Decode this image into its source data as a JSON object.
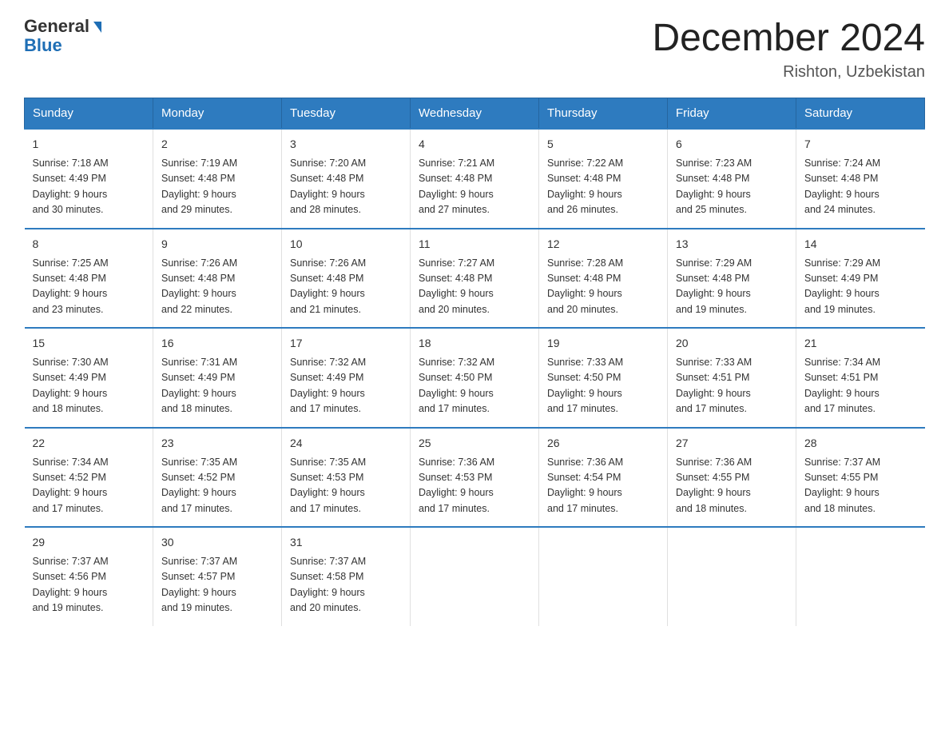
{
  "logo": {
    "general": "General",
    "blue": "Blue"
  },
  "title": "December 2024",
  "location": "Rishton, Uzbekistan",
  "headers": [
    "Sunday",
    "Monday",
    "Tuesday",
    "Wednesday",
    "Thursday",
    "Friday",
    "Saturday"
  ],
  "weeks": [
    [
      {
        "day": "1",
        "sunrise": "7:18 AM",
        "sunset": "4:49 PM",
        "daylight": "9 hours and 30 minutes."
      },
      {
        "day": "2",
        "sunrise": "7:19 AM",
        "sunset": "4:48 PM",
        "daylight": "9 hours and 29 minutes."
      },
      {
        "day": "3",
        "sunrise": "7:20 AM",
        "sunset": "4:48 PM",
        "daylight": "9 hours and 28 minutes."
      },
      {
        "day": "4",
        "sunrise": "7:21 AM",
        "sunset": "4:48 PM",
        "daylight": "9 hours and 27 minutes."
      },
      {
        "day": "5",
        "sunrise": "7:22 AM",
        "sunset": "4:48 PM",
        "daylight": "9 hours and 26 minutes."
      },
      {
        "day": "6",
        "sunrise": "7:23 AM",
        "sunset": "4:48 PM",
        "daylight": "9 hours and 25 minutes."
      },
      {
        "day": "7",
        "sunrise": "7:24 AM",
        "sunset": "4:48 PM",
        "daylight": "9 hours and 24 minutes."
      }
    ],
    [
      {
        "day": "8",
        "sunrise": "7:25 AM",
        "sunset": "4:48 PM",
        "daylight": "9 hours and 23 minutes."
      },
      {
        "day": "9",
        "sunrise": "7:26 AM",
        "sunset": "4:48 PM",
        "daylight": "9 hours and 22 minutes."
      },
      {
        "day": "10",
        "sunrise": "7:26 AM",
        "sunset": "4:48 PM",
        "daylight": "9 hours and 21 minutes."
      },
      {
        "day": "11",
        "sunrise": "7:27 AM",
        "sunset": "4:48 PM",
        "daylight": "9 hours and 20 minutes."
      },
      {
        "day": "12",
        "sunrise": "7:28 AM",
        "sunset": "4:48 PM",
        "daylight": "9 hours and 20 minutes."
      },
      {
        "day": "13",
        "sunrise": "7:29 AM",
        "sunset": "4:48 PM",
        "daylight": "9 hours and 19 minutes."
      },
      {
        "day": "14",
        "sunrise": "7:29 AM",
        "sunset": "4:49 PM",
        "daylight": "9 hours and 19 minutes."
      }
    ],
    [
      {
        "day": "15",
        "sunrise": "7:30 AM",
        "sunset": "4:49 PM",
        "daylight": "9 hours and 18 minutes."
      },
      {
        "day": "16",
        "sunrise": "7:31 AM",
        "sunset": "4:49 PM",
        "daylight": "9 hours and 18 minutes."
      },
      {
        "day": "17",
        "sunrise": "7:32 AM",
        "sunset": "4:49 PM",
        "daylight": "9 hours and 17 minutes."
      },
      {
        "day": "18",
        "sunrise": "7:32 AM",
        "sunset": "4:50 PM",
        "daylight": "9 hours and 17 minutes."
      },
      {
        "day": "19",
        "sunrise": "7:33 AM",
        "sunset": "4:50 PM",
        "daylight": "9 hours and 17 minutes."
      },
      {
        "day": "20",
        "sunrise": "7:33 AM",
        "sunset": "4:51 PM",
        "daylight": "9 hours and 17 minutes."
      },
      {
        "day": "21",
        "sunrise": "7:34 AM",
        "sunset": "4:51 PM",
        "daylight": "9 hours and 17 minutes."
      }
    ],
    [
      {
        "day": "22",
        "sunrise": "7:34 AM",
        "sunset": "4:52 PM",
        "daylight": "9 hours and 17 minutes."
      },
      {
        "day": "23",
        "sunrise": "7:35 AM",
        "sunset": "4:52 PM",
        "daylight": "9 hours and 17 minutes."
      },
      {
        "day": "24",
        "sunrise": "7:35 AM",
        "sunset": "4:53 PM",
        "daylight": "9 hours and 17 minutes."
      },
      {
        "day": "25",
        "sunrise": "7:36 AM",
        "sunset": "4:53 PM",
        "daylight": "9 hours and 17 minutes."
      },
      {
        "day": "26",
        "sunrise": "7:36 AM",
        "sunset": "4:54 PM",
        "daylight": "9 hours and 17 minutes."
      },
      {
        "day": "27",
        "sunrise": "7:36 AM",
        "sunset": "4:55 PM",
        "daylight": "9 hours and 18 minutes."
      },
      {
        "day": "28",
        "sunrise": "7:37 AM",
        "sunset": "4:55 PM",
        "daylight": "9 hours and 18 minutes."
      }
    ],
    [
      {
        "day": "29",
        "sunrise": "7:37 AM",
        "sunset": "4:56 PM",
        "daylight": "9 hours and 19 minutes."
      },
      {
        "day": "30",
        "sunrise": "7:37 AM",
        "sunset": "4:57 PM",
        "daylight": "9 hours and 19 minutes."
      },
      {
        "day": "31",
        "sunrise": "7:37 AM",
        "sunset": "4:58 PM",
        "daylight": "9 hours and 20 minutes."
      },
      null,
      null,
      null,
      null
    ]
  ],
  "labels": {
    "sunrise": "Sunrise: ",
    "sunset": "Sunset: ",
    "daylight": "Daylight: "
  }
}
